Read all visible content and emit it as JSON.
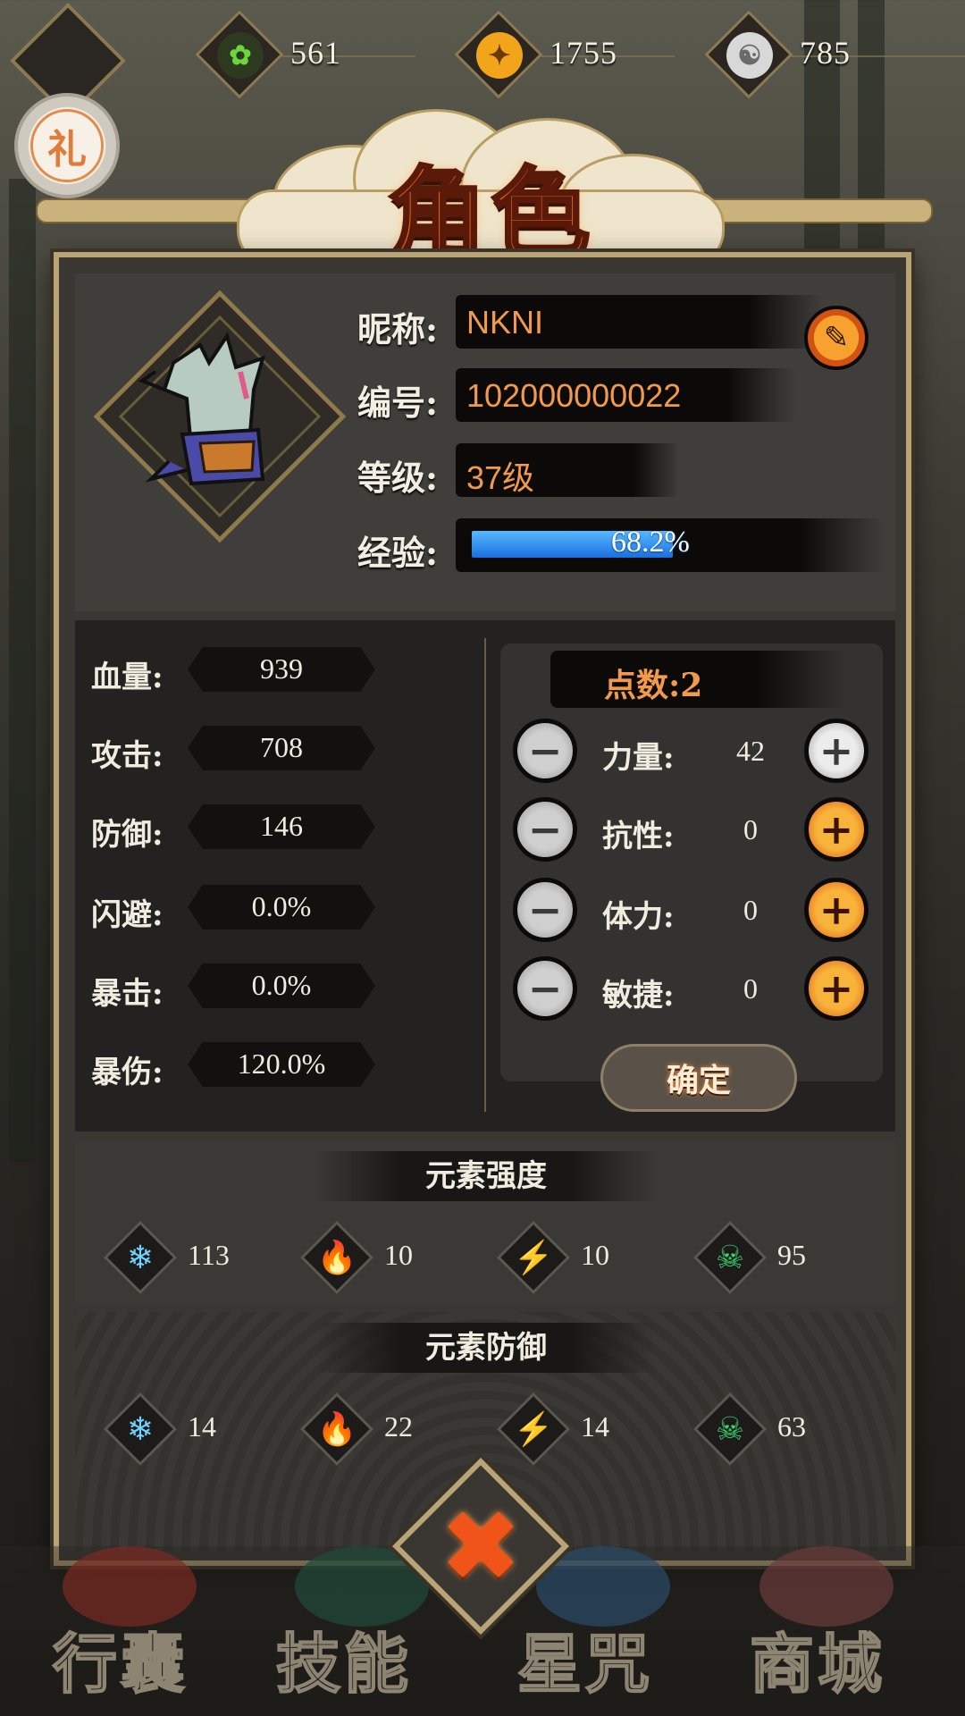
{
  "currency": [
    {
      "name": "jade-icon",
      "value": "561",
      "color": "#5cc93b"
    },
    {
      "name": "gold-coin-icon",
      "value": "1755",
      "color": "#f2a51a"
    },
    {
      "name": "swirl-coin-icon",
      "value": "785",
      "color": "#cfcfcf"
    }
  ],
  "gift_label": "礼",
  "title": "角色",
  "profile": {
    "nickname_label": "昵称:",
    "nickname": "NKNI",
    "id_label": "编号:",
    "id": "102000000022",
    "level_label": "等级:",
    "level": "37级",
    "exp_label": "经验:",
    "exp_text": "68.2%",
    "exp_fraction": 0.682
  },
  "stats": [
    {
      "label": "血量:",
      "value": "939"
    },
    {
      "label": "攻击:",
      "value": "708"
    },
    {
      "label": "防御:",
      "value": "146"
    },
    {
      "label": "闪避:",
      "value": "0.0%"
    },
    {
      "label": "暴击:",
      "value": "0.0%"
    },
    {
      "label": "暴伤:",
      "value": "120.0%"
    }
  ],
  "points": {
    "header": "点数:2",
    "rows": [
      {
        "label": "力量:",
        "value": "42"
      },
      {
        "label": "抗性:",
        "value": "0"
      },
      {
        "label": "体力:",
        "value": "0"
      },
      {
        "label": "敏捷:",
        "value": "0"
      }
    ],
    "confirm": "确定"
  },
  "element_strength": {
    "title": "元素强度",
    "items": [
      {
        "icon": "ice-icon",
        "value": "113"
      },
      {
        "icon": "fire-icon",
        "value": "10"
      },
      {
        "icon": "lightning-icon",
        "value": "10"
      },
      {
        "icon": "poison-skull-icon",
        "value": "95"
      }
    ]
  },
  "element_defense": {
    "title": "元素防御",
    "items": [
      {
        "icon": "ice-icon",
        "value": "14"
      },
      {
        "icon": "fire-icon",
        "value": "22"
      },
      {
        "icon": "lightning-icon",
        "value": "14"
      },
      {
        "icon": "poison-skull-icon",
        "value": "63"
      }
    ]
  },
  "nav": [
    "行囊",
    "技能",
    "星咒",
    "商城"
  ]
}
